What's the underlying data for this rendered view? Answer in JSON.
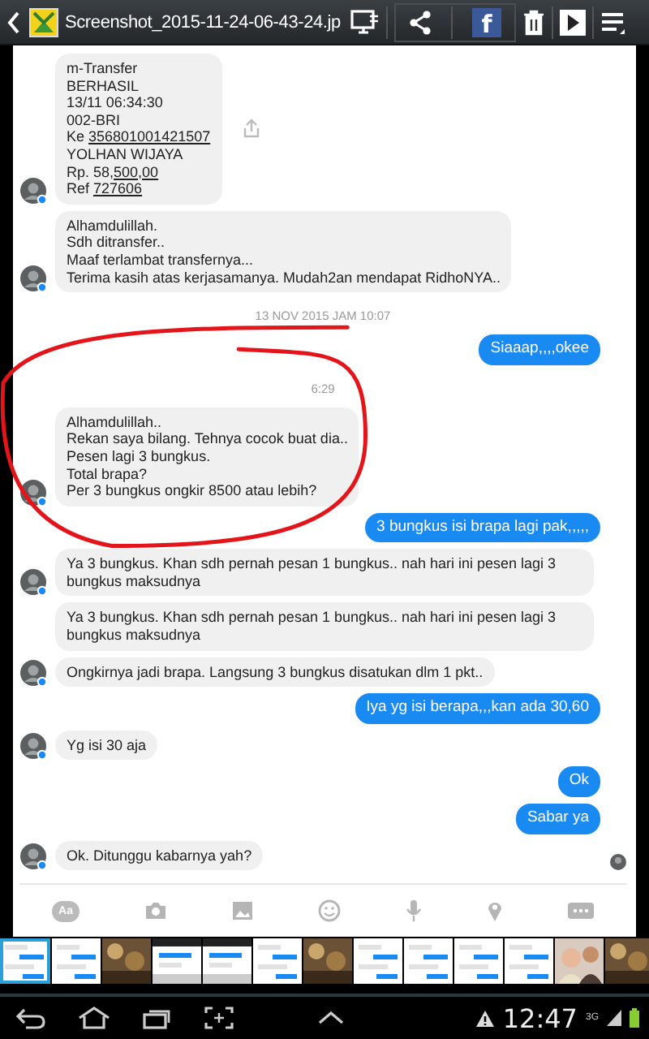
{
  "top_bar": {
    "title": "Screenshot_2015-11-24-06-43-24.jp",
    "facebook_label": "f"
  },
  "chat": {
    "messages": [
      {
        "kind": "received",
        "avatar": true,
        "share": true,
        "lines": [
          {
            "text": "m-Transfer"
          },
          {
            "text": "BERHASIL"
          },
          {
            "text": "13/11 06:34:30"
          },
          {
            "text": "002-BRI"
          },
          {
            "text": "Ke ",
            "link": "356801001421507"
          },
          {
            "text": "YOLHAN WIJAYA"
          },
          {
            "text": "Rp. 58,",
            "link": "500,00"
          },
          {
            "text": "Ref ",
            "link": "727606"
          }
        ]
      },
      {
        "kind": "received",
        "avatar": true,
        "share": false,
        "lines": [
          {
            "text": "Alhamdulillah."
          },
          {
            "text": "Sdh ditransfer.."
          },
          {
            "text": "Maaf terlambat transfernya..."
          },
          {
            "text": "Terima kasih atas kerjasamanya. Mudah2an mendapat RidhoNYA.."
          }
        ]
      },
      {
        "kind": "timestamp",
        "text": "13 NOV 2015 JAM 10:07"
      },
      {
        "kind": "sent",
        "text": "Siaaap,,,,okee"
      },
      {
        "kind": "timestamp",
        "text": "6:29"
      },
      {
        "kind": "received",
        "avatar": true,
        "share": false,
        "lines": [
          {
            "text": "Alhamdulillah.."
          },
          {
            "text": "Rekan saya bilang. Tehnya cocok buat dia.."
          },
          {
            "text": "Pesen lagi 3 bungkus."
          },
          {
            "text": "Total brapa?"
          },
          {
            "text": "Per 3 bungkus ongkir 8500 atau lebih?"
          }
        ]
      },
      {
        "kind": "sent",
        "text": "3 bungkus isi brapa lagi pak,,,,,"
      },
      {
        "kind": "received",
        "avatar": true,
        "share": false,
        "lines": [
          {
            "text": "Ya 3 bungkus. Khan sdh pernah pesan 1 bungkus.. nah hari ini pesen lagi 3 bungkus maksudnya"
          }
        ]
      },
      {
        "kind": "received",
        "avatar": false,
        "share": false,
        "lines": [
          {
            "text": "Ya 3 bungkus. Khan sdh pernah pesan 1 bungkus.. nah hari ini pesen lagi 3 bungkus maksudnya"
          }
        ]
      },
      {
        "kind": "received",
        "avatar": true,
        "share": false,
        "lines": [
          {
            "text": "Ongkirnya jadi brapa. Langsung 3 bungkus disatukan dlm 1 pkt.."
          }
        ]
      },
      {
        "kind": "sent",
        "text": "Iya yg isi berapa,,,kan ada 30,60"
      },
      {
        "kind": "received",
        "avatar": true,
        "share": false,
        "lines": [
          {
            "text": "Yg isi 30 aja"
          }
        ]
      },
      {
        "kind": "sent",
        "text": "Ok"
      },
      {
        "kind": "sent",
        "text": "Sabar ya"
      },
      {
        "kind": "received",
        "avatar": true,
        "share": false,
        "lines": [
          {
            "text": "Ok. Ditunggu kabarnya yah?"
          }
        ]
      }
    ],
    "seen_indicator": true,
    "composer_label": "Aa"
  },
  "annotation": {
    "kind": "circle"
  },
  "filmstrip": [
    {
      "selected": true
    },
    {
      "selected": false
    },
    {
      "selected": false
    },
    {
      "selected": false
    },
    {
      "selected": false
    },
    {
      "selected": false
    },
    {
      "selected": false
    },
    {
      "selected": false
    },
    {
      "selected": false
    },
    {
      "selected": false
    },
    {
      "selected": false
    },
    {
      "selected": false
    },
    {
      "selected": false
    }
  ],
  "status": {
    "time": "12:47",
    "network": "3G"
  }
}
